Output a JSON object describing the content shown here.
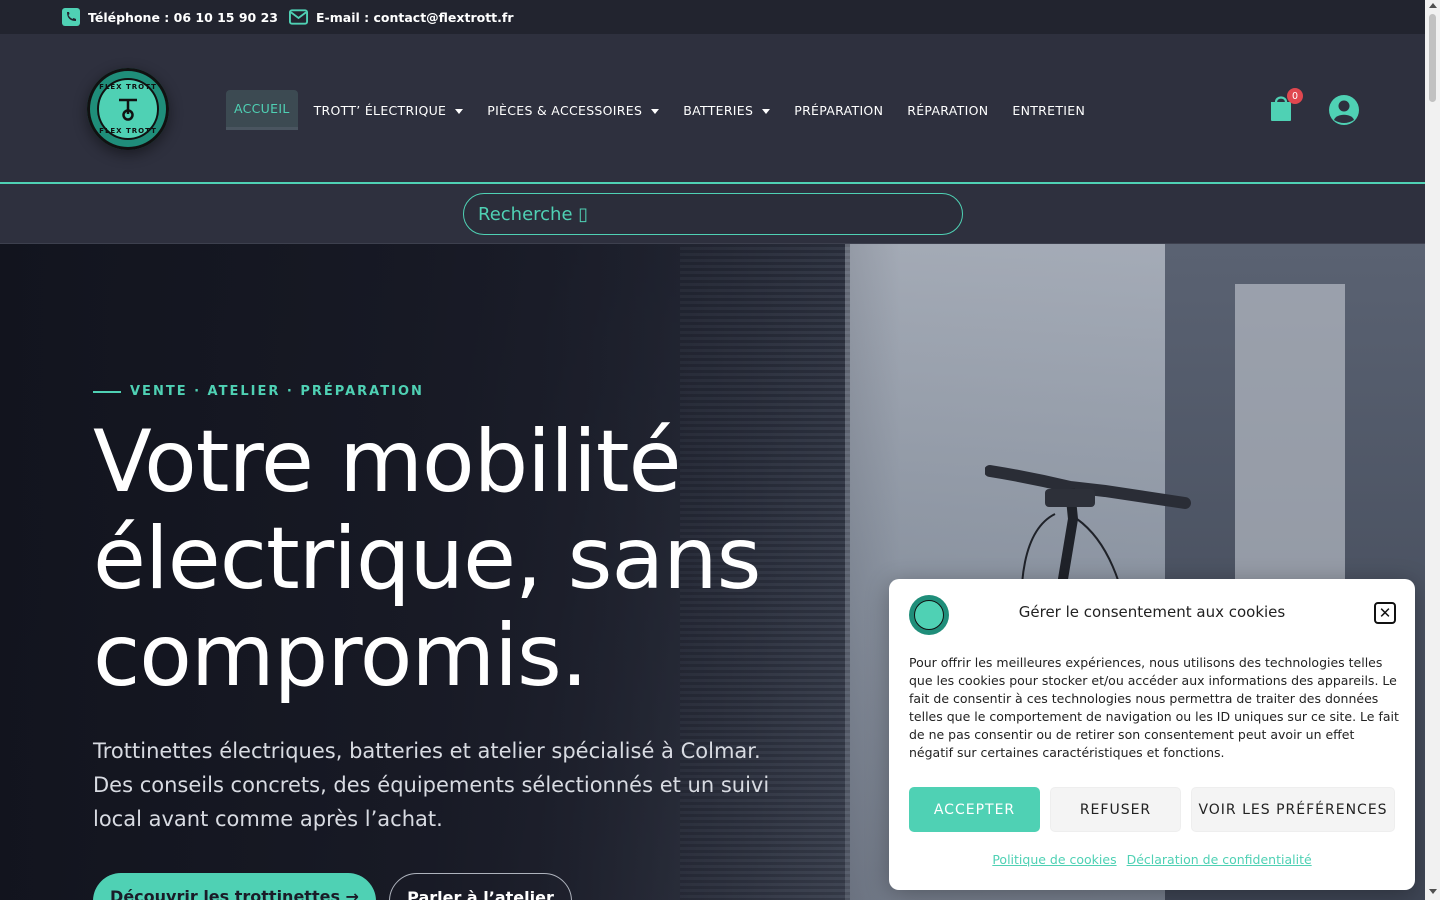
{
  "topbar": {
    "phone": "Téléphone : 06 10 15 90 23",
    "email": "E-mail : contact@flextrott.fr"
  },
  "logo": {
    "text_top": "FLEX TROTT",
    "text_bottom": "FLEX TROTT"
  },
  "nav": {
    "items": [
      {
        "label": "ACCUEIL",
        "active": true,
        "dropdown": false
      },
      {
        "label": "TROTT’ ÉLECTRIQUE",
        "active": false,
        "dropdown": true
      },
      {
        "label": "PIÈCES & ACCESSOIRES",
        "active": false,
        "dropdown": true
      },
      {
        "label": "BATTERIES",
        "active": false,
        "dropdown": true
      },
      {
        "label": "PRÉPARATION",
        "active": false,
        "dropdown": false
      },
      {
        "label": "RÉPARATION",
        "active": false,
        "dropdown": false
      },
      {
        "label": "ENTRETIEN",
        "active": false,
        "dropdown": false
      }
    ]
  },
  "cart": {
    "count": "0",
    "icon": "shopping-bag-icon"
  },
  "account": {
    "icon": "user-icon"
  },
  "search": {
    "placeholder": "Recherche ▯"
  },
  "hero": {
    "eyebrow": "VENTE · ATELIER · PRÉPARATION",
    "title_line1": "Votre mobilité",
    "title_line2": "électrique, sans",
    "title_line3": "compromis.",
    "lead": "Trottinettes électriques, batteries et atelier spécialisé à Colmar. Des conseils concrets, des équipements sélectionnés et un suivi local avant comme après l’achat.",
    "primary_button": "Découvrir les trottinettes →",
    "secondary_button": "Parler à l’atelier"
  },
  "cookie": {
    "title": "Gérer le consentement aux cookies",
    "text": "Pour offrir les meilleures expériences, nous utilisons des technologies telles que les cookies pour stocker et/ou accéder aux informations des appareils. Le fait de consentir à ces technologies nous permettra de traiter des données telles que le comportement de navigation ou les ID uniques sur ce site. Le fait de ne pas consentir ou de retirer son consentement peut avoir un effet négatif sur certaines caractéristiques et fonctions.",
    "accept": "ACCEPTER",
    "refuse": "REFUSER",
    "preferences": "VOIR LES PRÉFÉRENCES",
    "link_cookies": "Politique de cookies",
    "link_privacy": "Déclaration de confidentialité"
  },
  "colors": {
    "accent": "#4fd1b4",
    "header_bg": "#2e303e",
    "topbar_bg": "#22242f",
    "badge": "#e0474f"
  }
}
